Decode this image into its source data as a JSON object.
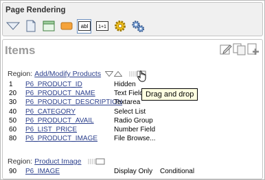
{
  "rendering": {
    "title": "Page Rendering",
    "toolbar": [
      {
        "icon": "triangle-down-icon"
      },
      {
        "icon": "page-icon"
      },
      {
        "icon": "region-icon"
      },
      {
        "icon": "button-icon"
      },
      {
        "icon": "item-abl-icon",
        "label": "abl",
        "selected": true
      },
      {
        "icon": "item-1x1-icon",
        "label": "1+1"
      },
      {
        "icon": "gear-icon"
      },
      {
        "icon": "gears-icon"
      }
    ]
  },
  "items_panel": {
    "title": "Items",
    "tool_icons": [
      "edit-icon",
      "copy-icon",
      "add-icon"
    ],
    "regions": [
      {
        "prefix": "Region:",
        "name": "Add/Modify Products",
        "items": [
          {
            "seq": "1",
            "name": "P6_PRODUCT_ID",
            "type": "Hidden",
            "cond": ""
          },
          {
            "seq": "20",
            "name": "P6_PRODUCT_NAME",
            "type": "Text Field",
            "cond": ""
          },
          {
            "seq": "30",
            "name": "P6_PRODUCT_DESCRIPTION",
            "type": "Textarea",
            "cond": ""
          },
          {
            "seq": "40",
            "name": "P6_CATEGORY",
            "type": "Select List",
            "cond": ""
          },
          {
            "seq": "50",
            "name": "P6_PRODUCT_AVAIL",
            "type": "Radio Group",
            "cond": ""
          },
          {
            "seq": "60",
            "name": "P6_LIST_PRICE",
            "type": "Number Field",
            "cond": ""
          },
          {
            "seq": "80",
            "name": "P6_PRODUCT_IMAGE",
            "type": "File Browse...",
            "cond": ""
          }
        ]
      },
      {
        "prefix": "Region:",
        "name": "Product Image",
        "items": [
          {
            "seq": "90",
            "name": "P6_IMAGE",
            "type": "Display Only",
            "cond": "Conditional"
          }
        ]
      }
    ]
  },
  "tooltip": {
    "text": "Drag and drop"
  }
}
